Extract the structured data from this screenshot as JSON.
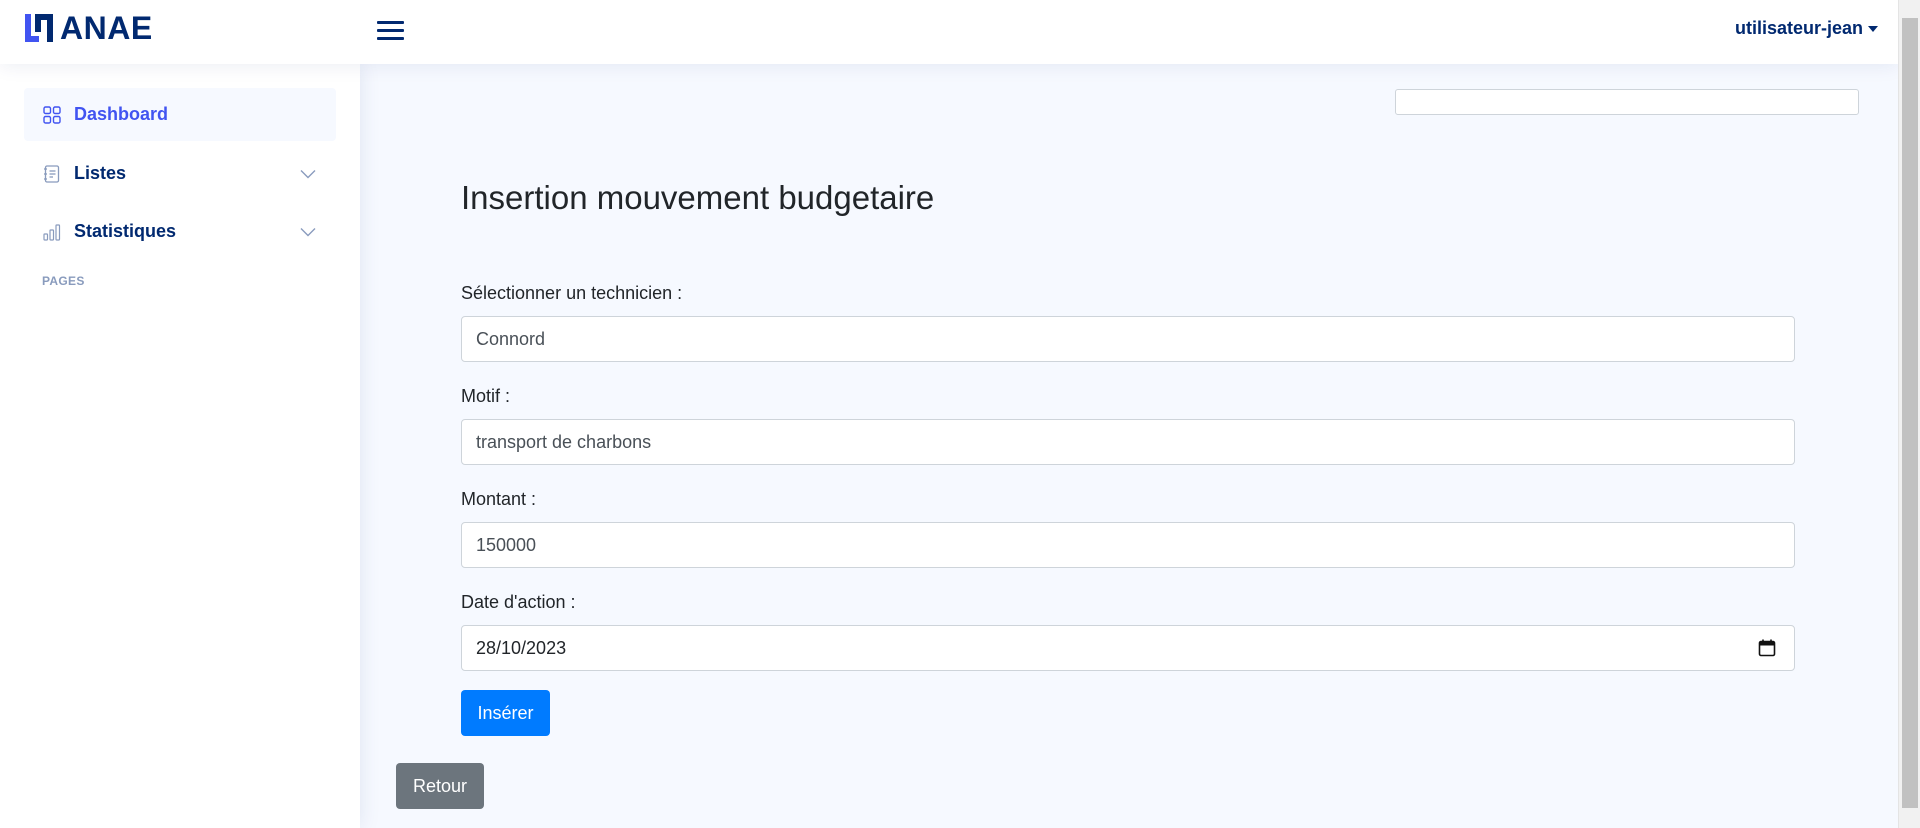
{
  "header": {
    "logo_text": "ANAE",
    "user_name": "utilisateur-jean"
  },
  "sidebar": {
    "items": [
      {
        "label": "Dashboard",
        "icon": "grid-icon",
        "active": true
      },
      {
        "label": "Listes",
        "icon": "journal-text-icon",
        "expandable": true
      },
      {
        "label": "Statistiques",
        "icon": "bar-chart-icon",
        "expandable": true
      }
    ],
    "heading": "Pages"
  },
  "main": {
    "search_value": "",
    "title": "Insertion mouvement budgetaire",
    "fields": [
      {
        "label": "Sélectionner un technicien :",
        "value": "Connord"
      },
      {
        "label": "Motif :",
        "value": "transport de charbons"
      },
      {
        "label": "Montant :",
        "value": "150000"
      },
      {
        "label": "Date d'action :",
        "value": "28/10/2023"
      }
    ],
    "submit_label": "Insérer",
    "back_label": "Retour"
  },
  "colors": {
    "brand": "#012970",
    "accent": "#4154f1",
    "primary_button": "#007bff",
    "secondary_button": "#6c757d"
  }
}
